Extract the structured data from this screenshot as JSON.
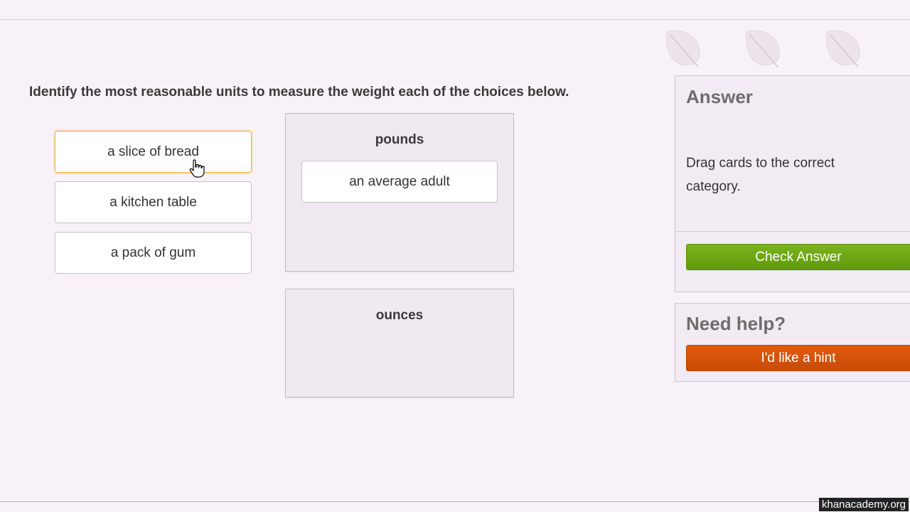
{
  "question": "Identify the most reasonable units to measure the weight each of the choices below.",
  "cards": [
    "a slice of bread",
    "a kitchen table",
    "a pack of gum"
  ],
  "bins": [
    {
      "title": "pounds",
      "cards": [
        "an average adult"
      ]
    },
    {
      "title": "ounces",
      "cards": []
    }
  ],
  "answer_panel": {
    "title": "Answer",
    "instruction": "Drag cards to the correct category.",
    "check_button": "Check Answer"
  },
  "help_panel": {
    "title": "Need help?",
    "hint_button": "I'd like a hint"
  },
  "watermark": "khanacademy.org",
  "colors": {
    "check_button": "#6ea816",
    "hint_button": "#d4550a",
    "active_card_border": "#f2b13a"
  },
  "icons": [
    "leaf-icon",
    "leaf-icon",
    "leaf-icon",
    "hand-cursor-icon"
  ]
}
